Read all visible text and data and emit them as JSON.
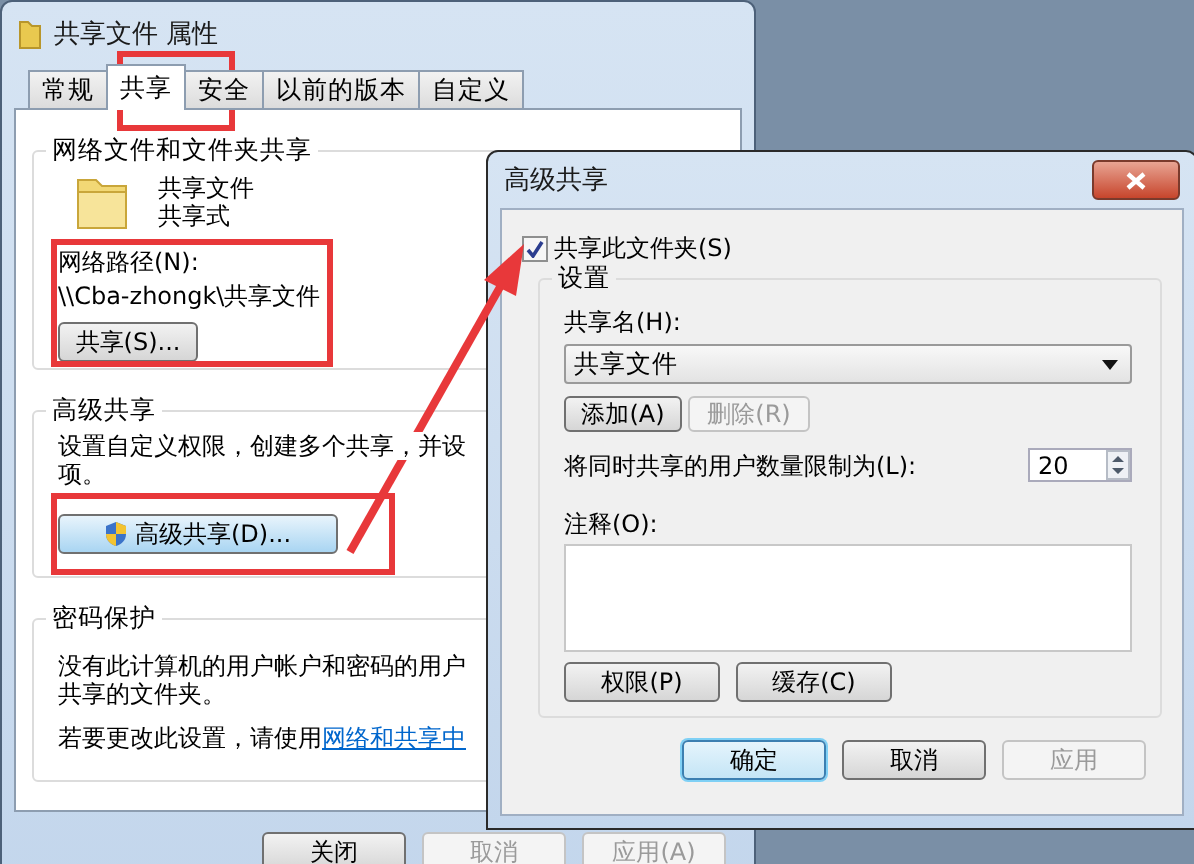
{
  "properties_window": {
    "title": "共享文件 属性",
    "tabs": [
      {
        "label": "常规",
        "selected": false
      },
      {
        "label": "共享",
        "selected": true
      },
      {
        "label": "安全",
        "selected": false
      },
      {
        "label": "以前的版本",
        "selected": false
      },
      {
        "label": "自定义",
        "selected": false
      }
    ],
    "network_sharing": {
      "heading": "网络文件和文件夹共享",
      "folder_name": "共享文件",
      "folder_status": "共享式",
      "path_label": "网络路径(N):",
      "path": "\\\\Cba-zhongk\\共享文件",
      "share_button": "共享(S)..."
    },
    "advanced_sharing": {
      "heading": "高级共享",
      "description": [
        "设置自定义权限，创建多个共享，并设",
        "项。"
      ],
      "button": "高级共享(D)..."
    },
    "password_protection": {
      "heading": "密码保护",
      "description": [
        "没有此计算机的用户帐户和密码的用户",
        "共享的文件夹。"
      ],
      "change_text": "若要更改此设置，请使用",
      "link": "网络和共享中"
    },
    "buttons": [
      {
        "label": "关闭",
        "disabled": false
      },
      {
        "label": "取消",
        "disabled": true
      },
      {
        "label": "应用(A)",
        "disabled": true
      }
    ]
  },
  "advanced_sharing_dialog": {
    "title": "高级共享",
    "share_checkbox": {
      "label": "共享此文件夹(S)",
      "checked": true
    },
    "settings": {
      "heading": "设置",
      "share_name_label": "共享名(H):",
      "share_name": "共享文件",
      "name_buttons": [
        {
          "label": "添加(A)",
          "disabled": false
        },
        {
          "label": "删除(R)",
          "disabled": true
        }
      ],
      "user_limit_label": "将同时共享的用户数量限制为(L):",
      "user_limit": "20",
      "comment_label": "注释(O):",
      "extra_buttons": [
        {
          "label": "权限(P)",
          "disabled": false
        },
        {
          "label": "缓存(C)",
          "disabled": false
        }
      ]
    },
    "buttons": [
      {
        "label": "确定",
        "disabled": false,
        "default": true
      },
      {
        "label": "取消",
        "disabled": false,
        "default": false
      },
      {
        "label": "应用",
        "disabled": true,
        "default": false
      }
    ]
  }
}
